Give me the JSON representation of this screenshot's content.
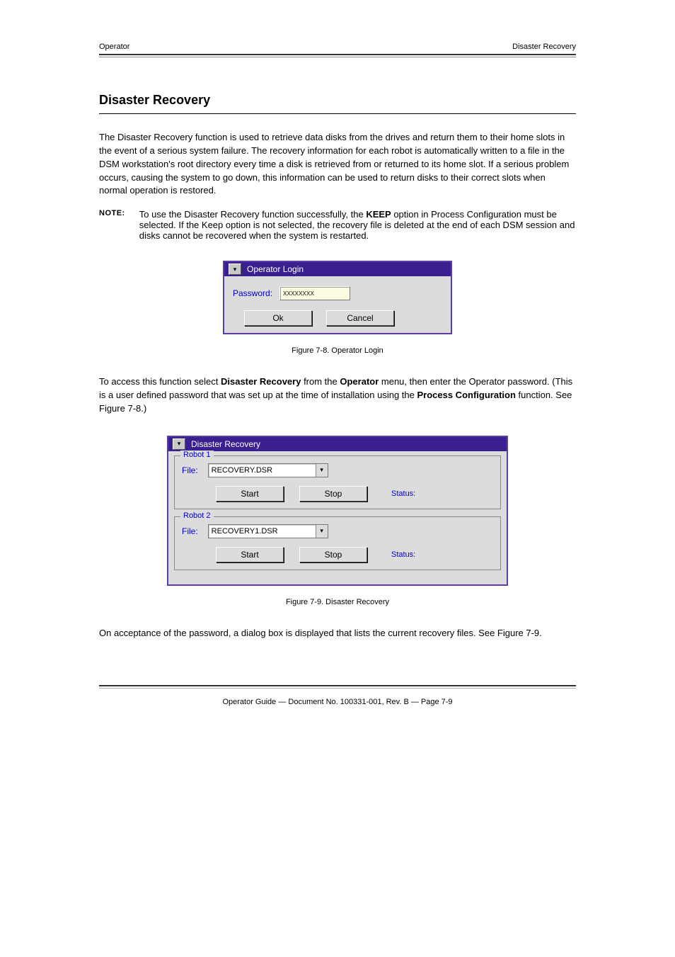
{
  "header": {
    "left": "Operator",
    "right": "Disaster Recovery"
  },
  "section_title": "Disaster Recovery",
  "para1": "The Disaster Recovery function is used to retrieve data disks from the drives and return them to their home slots in the event of a serious system failure. The recovery information for each robot is automatically written to a file in the DSM workstation's root directory every time a disk is retrieved from or returned to its home slot. If a serious problem occurs, causing the system to go down, this information can be used to return disks to their correct slots when normal operation is restored.",
  "note": {
    "label": "NOTE:",
    "text_before": "To use the Disaster Recovery function successfully, the ",
    "bold1": "KEEP",
    "text_after": " option in Process Configuration must be selected. If the Keep option is not selected, the recovery file is deleted at the end of each DSM session and disks cannot be recovered when the system is restarted."
  },
  "login_window": {
    "title": "Operator Login",
    "password_label": "Password:",
    "password_value": "xxxxxxxx",
    "ok_label": "Ok",
    "cancel_label": "Cancel"
  },
  "caption1": "Figure 7-8. Operator Login",
  "para2a": "To access this function select ",
  "para2b": "Disaster Recovery",
  "para2c": " from the ",
  "para2d": "Operator",
  "para2e": " menu, then enter the Operator password. (This is a user defined password that was set up at the time of installation using the ",
  "para2f": "Process Configuration",
  "para2g": " function. See Figure 7-8.)",
  "dr_window": {
    "title": "Disaster Recovery",
    "robot1": {
      "legend": "Robot 1",
      "file_label": "File:",
      "file_value": "RECOVERY.DSR",
      "start_label": "Start",
      "stop_label": "Stop",
      "status_label": "Status:"
    },
    "robot2": {
      "legend": "Robot 2",
      "file_label": "File:",
      "file_value": "RECOVERY1.DSR",
      "start_label": "Start",
      "stop_label": "Stop",
      "status_label": "Status:"
    }
  },
  "caption2": "Figure 7-9. Disaster Recovery",
  "para3": "On acceptance of the password, a dialog box is displayed that lists the current recovery files. See Figure 7-9.",
  "footer": "Operator Guide — Document No. 100331-001, Rev. B — Page 7-9"
}
